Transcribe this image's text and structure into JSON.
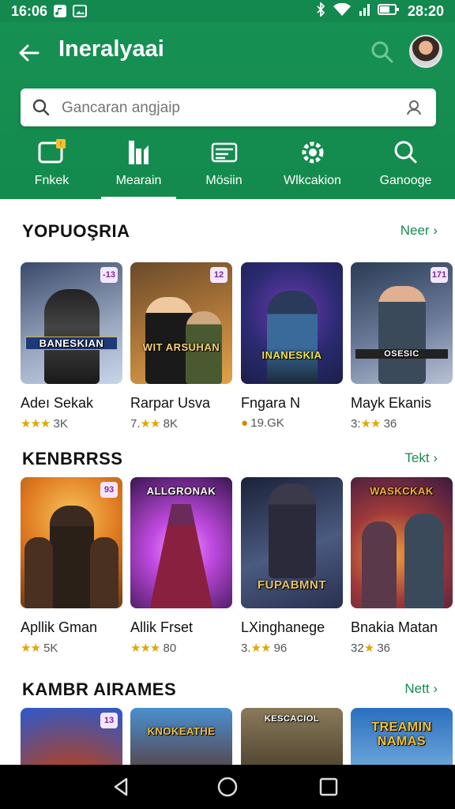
{
  "status_bar": {
    "time_left": "16:06",
    "time_right": "28:20"
  },
  "app_bar": {
    "title": "Ineralyaai"
  },
  "search": {
    "placeholder": "Gancaran angjaip"
  },
  "tabs": [
    {
      "label": "Fnkek",
      "icon": "game-icon"
    },
    {
      "label": "Mearain",
      "icon": "chart-icon"
    },
    {
      "label": "Mösiin",
      "icon": "card-icon"
    },
    {
      "label": "Wlkcakion",
      "icon": "gear-icon"
    },
    {
      "label": "Ganooge",
      "icon": "search-icon"
    }
  ],
  "active_tab": 1,
  "sections": [
    {
      "title": "YOPUOŞRIA",
      "more": "Neer",
      "items": [
        {
          "name": "Adeı Sekak",
          "stars": "★★★",
          "rating": "3K",
          "badge": "-13",
          "banner": "BANESKIAN",
          "colors": [
            "#3a4a6a",
            "#c9d6ea"
          ]
        },
        {
          "name": "Rarpar Usva",
          "stars": "★★",
          "rating_prefix": "7.",
          "rating": "8K",
          "badge": "12",
          "banner": "WIT ARSUHAN",
          "colors": [
            "#6b4a2a",
            "#e0a24a"
          ]
        },
        {
          "name": "Fngara N",
          "stars": "●",
          "rating": "19.GK",
          "badge": "",
          "banner": "INANESKIA",
          "colors": [
            "#1b1f4a",
            "#6a3ab0"
          ]
        },
        {
          "name": "Mayk Ekanis",
          "stars": "★★",
          "rating_prefix": "3:",
          "rating": "36",
          "badge": "171",
          "banner": "OSESIC",
          "colors": [
            "#2a3b55",
            "#b8c2d6"
          ]
        }
      ]
    },
    {
      "title": "KENBRRSS",
      "more": "Tekt",
      "items": [
        {
          "name": "Apllik Gman",
          "stars": "★★",
          "rating_prefix": "",
          "rating": "5K",
          "badge": "93",
          "banner": "",
          "colors": [
            "#7a3a10",
            "#f09a2a"
          ]
        },
        {
          "name": "Allik Frset",
          "stars": "★★★",
          "rating": "80",
          "badge": "",
          "banner": "ALLGRONAK",
          "colors": [
            "#3a1550",
            "#c04ae0"
          ]
        },
        {
          "name": "LXinghanege",
          "stars": "★★",
          "rating_prefix": "3.",
          "rating": "96",
          "badge": "",
          "banner": "FUPABMNT",
          "colors": [
            "#1a2238",
            "#4a5a80"
          ]
        },
        {
          "name": "Bnakia Matan",
          "stars": "★",
          "rating_prefix": "32",
          "rating": "36",
          "badge": "",
          "banner": "WASKCKAK",
          "colors": [
            "#3a1a40",
            "#e0602a"
          ]
        }
      ]
    },
    {
      "title": "KAMBR AIRAMES",
      "more": "Nett",
      "items": [
        {
          "name": "",
          "badge": "13",
          "banner": "",
          "colors": [
            "#b8401a",
            "#2a5ad0"
          ]
        },
        {
          "name": "",
          "badge": "",
          "banner": "KNOKEATHE",
          "colors": [
            "#5a2a1a",
            "#4a90d0"
          ]
        },
        {
          "name": "",
          "badge": "",
          "banner": "KESCACIOL",
          "colors": [
            "#3a3022",
            "#8a7a5a"
          ]
        },
        {
          "name": "",
          "badge": "",
          "banner": "TREAMIN NAMAS",
          "colors": [
            "#2a70c0",
            "#f0c040"
          ]
        }
      ]
    }
  ]
}
